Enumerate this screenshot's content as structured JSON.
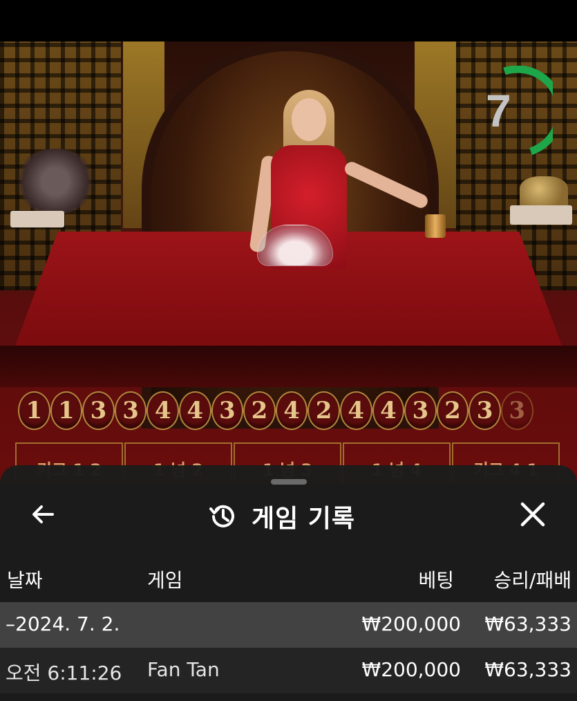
{
  "timer": {
    "value": "7"
  },
  "history": {
    "results": [
      "1",
      "1",
      "3",
      "3",
      "4",
      "4",
      "3",
      "2",
      "4",
      "2",
      "4",
      "4",
      "3",
      "2",
      "3",
      "3"
    ]
  },
  "bet_spots": [
    "키그 1 2",
    "1 넘 2",
    "1 넘 3",
    "1 넘 4",
    "키그 4 1"
  ],
  "panel": {
    "title": "게임 기록",
    "columns": {
      "date": "날짜",
      "game": "게임",
      "bet": "베팅",
      "win_loss": "승리/패배"
    },
    "day_group": {
      "date": "–2024. 7. 2.",
      "bet": "₩200,000",
      "win_loss": "₩63,333"
    },
    "rows": [
      {
        "time": "오전 6:11:26",
        "game": "Fan Tan",
        "bet": "₩200,000",
        "win_loss": "₩63,333"
      }
    ]
  },
  "colors": {
    "timer_arc": "#1ea64a",
    "bead_gold": "#b2883e",
    "panel_bg": "#1c1c1c"
  }
}
